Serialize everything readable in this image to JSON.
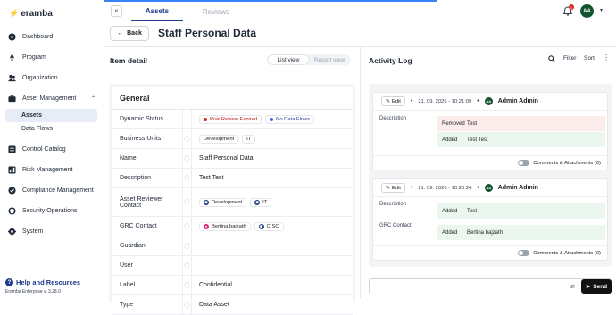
{
  "app": {
    "logo_text": "eramba",
    "version": "Eramba Enterprise v. 3.28.0",
    "help": "Help and Resources"
  },
  "sidebar": {
    "items": [
      {
        "label": "Dashboard",
        "icon": "dashboard-icon"
      },
      {
        "label": "Program",
        "icon": "rocket-icon"
      },
      {
        "label": "Organization",
        "icon": "users-icon"
      },
      {
        "label": "Asset Management",
        "icon": "briefcase-icon"
      },
      {
        "label": "Control Catalog",
        "icon": "list-icon"
      },
      {
        "label": "Risk Management",
        "icon": "chart-icon"
      },
      {
        "label": "Compliance Management",
        "icon": "check-circle-icon"
      },
      {
        "label": "Security Operations",
        "icon": "shield-icon"
      },
      {
        "label": "System",
        "icon": "gear-icon"
      }
    ],
    "subitems": [
      {
        "label": "Assets"
      },
      {
        "label": "Data Flows"
      }
    ]
  },
  "header": {
    "tabs": [
      {
        "label": "Assets"
      },
      {
        "label": "Reviews"
      }
    ],
    "notification_count": "1",
    "avatar": "AA"
  },
  "title_bar": {
    "back_label": "Back",
    "title": "Staff Personal Data"
  },
  "left_panel": {
    "title": "Item detail",
    "view_toggle": {
      "list": "List view",
      "report": "Report view"
    },
    "section": "General",
    "rows": {
      "status": {
        "label": "Dynamic Status",
        "tags": [
          "Risk Review Expired",
          "No Data Flows"
        ]
      },
      "bu": {
        "label": "Business Units",
        "tags": [
          "Development",
          "IT"
        ]
      },
      "name": {
        "label": "Name",
        "value": "Staff Personal Data"
      },
      "desc": {
        "label": "Description",
        "value": "Test Test"
      },
      "reviewer": {
        "label": "Asset Reviewer Contact",
        "tags": [
          "Development",
          "IT"
        ]
      },
      "grc": {
        "label": "GRC Contact",
        "tags": [
          "Bertina bajzath",
          "CISO"
        ]
      },
      "guardian": {
        "label": "Guardian"
      },
      "user": {
        "label": "User"
      },
      "label": {
        "label": "Label",
        "value": "Confidential"
      },
      "type": {
        "label": "Type",
        "value": "Data Asset"
      }
    }
  },
  "activity": {
    "title": "Activity Log",
    "filter": "Filter",
    "sort": "Sort",
    "entries": [
      {
        "edit": "Edit",
        "timestamp": "21. 09. 2025 - 10:21:09",
        "avatar": "AA",
        "user": "Admin Admin",
        "field": "Description",
        "changes": [
          {
            "kind": "Removed",
            "text": "Test"
          },
          {
            "kind": "Added",
            "text": "Test Test"
          }
        ],
        "footer": "Comments & Attachments (0)"
      },
      {
        "edit": "Edit",
        "timestamp": "21. 09. 2025 - 10:20:24",
        "avatar": "AA",
        "user": "Admin Admin",
        "fields": [
          {
            "field": "Description",
            "kind": "Added",
            "text": "Test"
          },
          {
            "field": "GRC Contact",
            "kind": "Added",
            "text": "Bertina bajzath"
          }
        ],
        "footer": "Comments & Attachments (0)"
      }
    ],
    "send": "Send"
  },
  "colors": {
    "accent": "#1e3a8a",
    "danger": "#dc2626",
    "avatar": "#14532d",
    "info": "#2563eb"
  }
}
